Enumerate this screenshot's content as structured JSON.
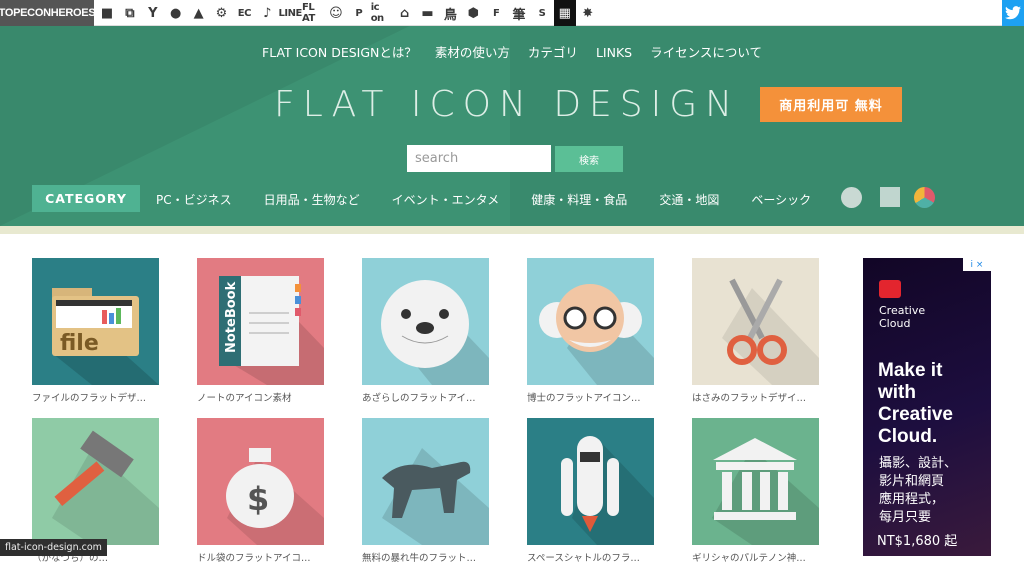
{
  "topbar": {
    "brand": "TOPECONHEROES",
    "sites": [
      {
        "icon": "animal-icon",
        "label": "■",
        "text": false
      },
      {
        "icon": "copy-icon",
        "label": "⧉",
        "text": false
      },
      {
        "icon": "person-icon",
        "label": "Y",
        "text": false
      },
      {
        "icon": "speech-bubble-icon",
        "label": "●",
        "text": false
      },
      {
        "icon": "arrow-icon",
        "label": "▲",
        "text": false
      },
      {
        "icon": "gear-icon",
        "label": "⚙",
        "text": false
      },
      {
        "icon": "ec-icon",
        "label": "EC",
        "text": true
      },
      {
        "icon": "music-note-icon",
        "label": "♪",
        "text": false
      },
      {
        "icon": "line-icon",
        "label": "LINE",
        "text": true
      },
      {
        "icon": "flat-icon",
        "label": "FL AT",
        "text": true
      },
      {
        "icon": "smile-icon",
        "label": "☺",
        "text": false
      },
      {
        "icon": "parking-icon",
        "label": "P",
        "text": true
      },
      {
        "icon": "icon-text-icon",
        "label": "ic on",
        "text": true
      },
      {
        "icon": "house-icon",
        "label": "⌂",
        "text": false
      },
      {
        "icon": "bed-icon",
        "label": "▬",
        "text": false
      },
      {
        "icon": "bird-icon",
        "label": "鳥",
        "text": false
      },
      {
        "icon": "hexagon-icon",
        "label": "⬢",
        "text": false
      },
      {
        "icon": "font-icon",
        "label": "F",
        "text": true
      },
      {
        "icon": "brush-icon",
        "label": "筆",
        "text": false
      },
      {
        "icon": "s-tool-icon",
        "label": "S",
        "text": true
      },
      {
        "icon": "grid-icon",
        "label": "▦",
        "text": false
      },
      {
        "icon": "firework-icon",
        "label": "✸",
        "text": false
      }
    ]
  },
  "nav": [
    "FLAT ICON DESIGNとは？",
    "素材の使い方",
    "カテゴリ",
    "LINKS",
    "ライセンスについて"
  ],
  "header": {
    "title": "FLAT ICON DESIGN",
    "badge": "商用利用可 無料"
  },
  "search": {
    "placeholder": "search",
    "button": "検索"
  },
  "category": {
    "label": "CATEGORY",
    "items": [
      "PC・ビジネス",
      "日用品・生物など",
      "イベント・エンタメ",
      "健康・料理・食品",
      "交通・地図",
      "ベーシック"
    ]
  },
  "cards": [
    {
      "caption": "ファイルのフラットデザ…",
      "bg": "#2b7f86",
      "name": "file-folder-icon"
    },
    {
      "caption": "ノートのアイコン素材",
      "bg": "#e27b82",
      "name": "notebook-icon"
    },
    {
      "caption": "あざらしのフラットアイ…",
      "bg": "#8fd0d8",
      "name": "seal-icon"
    },
    {
      "caption": "博士のフラットアイコン…",
      "bg": "#8fd0d8",
      "name": "professor-icon"
    },
    {
      "caption": "はさみのフラットデザイ…",
      "bg": "#e8e2d2",
      "name": "scissors-icon"
    },
    {
      "caption": "（かなづち）の…",
      "bg": "#8fcba6",
      "name": "hammer-icon"
    },
    {
      "caption": "ドル袋のフラットアイコ…",
      "bg": "#e27b82",
      "name": "money-bag-icon"
    },
    {
      "caption": "無料の暴れ牛のフラット…",
      "bg": "#8fd0d8",
      "name": "bull-icon"
    },
    {
      "caption": "スペースシャトルのフラ…",
      "bg": "#2b7f86",
      "name": "space-shuttle-icon"
    },
    {
      "caption": "ギリシャのパルテノン神…",
      "bg": "#6bb38e",
      "name": "temple-icon"
    }
  ],
  "ad": {
    "brand": "Creative\nCloud",
    "headline": "Make it\nwith\nCreative\nCloud.",
    "sub": "攝影、設計、\n影片和網頁\n應用程式，\n每月只要",
    "price": "NT$1,680 起",
    "choice": "i ×"
  },
  "status": "flat-icon-design.com"
}
